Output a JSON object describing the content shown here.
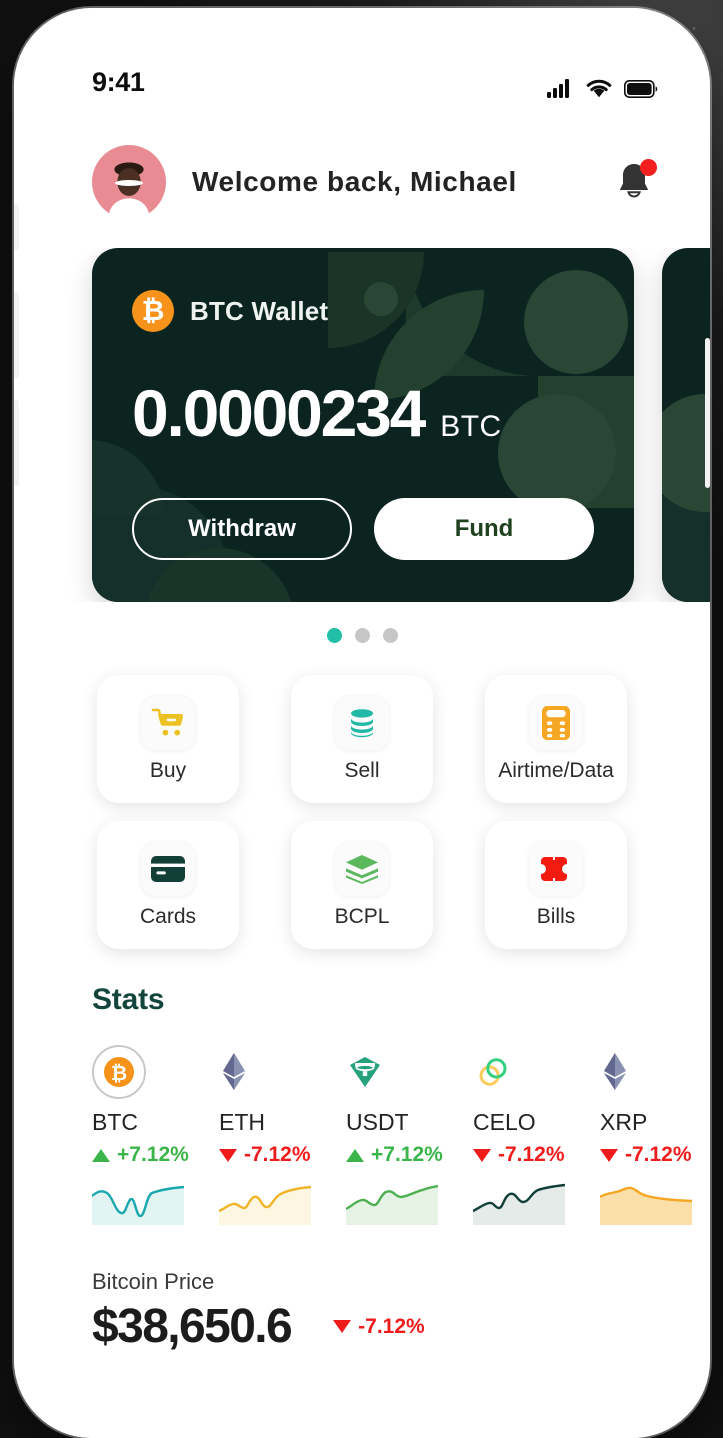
{
  "status_bar": {
    "time": "9:41",
    "cellular_icon": "signal-bars-icon",
    "wifi_icon": "wifi-icon",
    "battery_icon": "battery-full-icon"
  },
  "header": {
    "avatar_icon": "user-avatar",
    "greeting": "Welcome back, Michael",
    "notification_icon": "bell-icon",
    "has_unread": true
  },
  "wallet_carousel": {
    "cards": [
      {
        "coin_symbol": "₿",
        "coin_icon": "bitcoin-icon",
        "title": "BTC Wallet",
        "balance": "0.0000234",
        "currency": "BTC",
        "withdraw_label": "Withdraw",
        "fund_label": "Fund",
        "card_color": "#0b2420",
        "accent_color": "#f7931a"
      }
    ],
    "dots": [
      {
        "active": true
      },
      {
        "active": false
      },
      {
        "active": false
      }
    ],
    "active_color": "#21bfa6",
    "inactive_color": "#c6c6c6"
  },
  "actions": {
    "items": [
      {
        "label": "Buy",
        "icon": "shopping-cart-icon",
        "color": "#ecc223"
      },
      {
        "label": "Sell",
        "icon": "coin-stack-icon",
        "color": "#22b8a6"
      },
      {
        "label": "Airtime/Data",
        "icon": "calculator-icon",
        "color": "#f5a623"
      },
      {
        "label": "Cards",
        "icon": "credit-card-icon",
        "color": "#124038"
      },
      {
        "label": "BCPL",
        "icon": "layers-icon",
        "color": "#5cb85c"
      },
      {
        "label": "Bills",
        "icon": "voucher-icon",
        "color": "#f31b10"
      }
    ]
  },
  "stats": {
    "title": "Stats",
    "coins": [
      {
        "ticker": "BTC",
        "icon": "bitcoin-icon",
        "change": "+7.12%",
        "direction": "up",
        "selected": true,
        "line_color": "#1aa8ae",
        "fill_color": "#e3f5f3"
      },
      {
        "ticker": "ETH",
        "icon": "ethereum-icon",
        "change": "-7.12%",
        "direction": "down",
        "selected": false,
        "line_color": "#f0b429",
        "fill_color": "#fdf6e0"
      },
      {
        "ticker": "USDT",
        "icon": "tether-icon",
        "change": "+7.12%",
        "direction": "up",
        "selected": false,
        "line_color": "#4caf50",
        "fill_color": "#e6f3e4"
      },
      {
        "ticker": "CELO",
        "icon": "celo-icon",
        "change": "-7.12%",
        "direction": "down",
        "selected": false,
        "line_color": "#123f38",
        "fill_color": "#e4ebe9"
      },
      {
        "ticker": "XRP",
        "icon": "ethereum-icon",
        "change": "-7.12%",
        "direction": "down",
        "selected": false,
        "line_color": "#f5a623",
        "fill_color": "#fbdfa8"
      }
    ]
  },
  "price": {
    "label": "Bitcoin Price",
    "value": "$38,650.6",
    "change": "-7.12%",
    "direction": "down",
    "down_color": "#ef1c1c"
  },
  "chart_data": {
    "type": "line",
    "title": "Stats sparklines",
    "grid": false,
    "legend": "none",
    "series": [
      {
        "name": "BTC",
        "values": [
          62,
          74,
          70,
          48,
          16,
          60,
          70,
          18,
          48,
          76,
          84,
          86
        ]
      },
      {
        "name": "ETH",
        "values": [
          30,
          38,
          44,
          40,
          56,
          34,
          62,
          66,
          50,
          58,
          74,
          80
        ]
      },
      {
        "name": "USDT",
        "values": [
          34,
          42,
          52,
          48,
          60,
          44,
          68,
          82,
          74,
          70,
          78,
          86
        ]
      },
      {
        "name": "CELO",
        "values": [
          28,
          36,
          46,
          42,
          58,
          38,
          66,
          60,
          52,
          70,
          82,
          88
        ]
      },
      {
        "name": "XRP",
        "values": [
          70,
          62,
          58,
          60,
          64,
          72,
          78,
          68,
          54,
          50,
          52,
          48
        ]
      }
    ],
    "ylim": [
      0,
      100
    ]
  }
}
